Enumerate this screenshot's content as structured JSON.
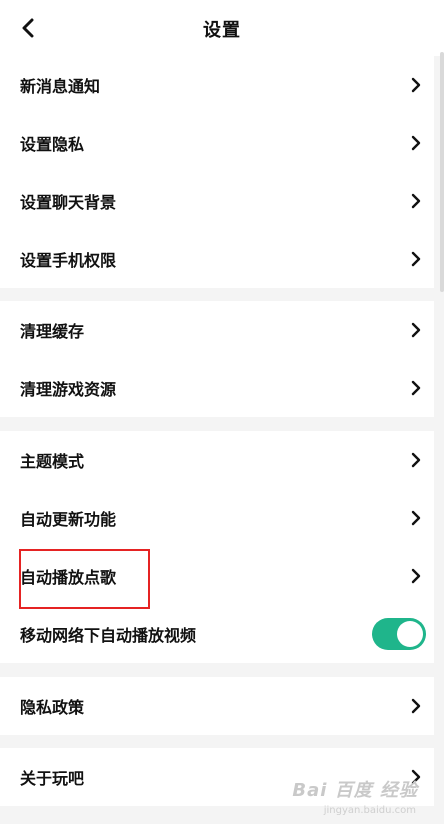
{
  "header": {
    "title": "设置",
    "back_icon": "chevron-left-icon"
  },
  "groups": [
    {
      "items": [
        {
          "label": "新消息通知"
        },
        {
          "label": "设置隐私"
        },
        {
          "label": "设置聊天背景"
        },
        {
          "label": "设置手机权限"
        }
      ]
    },
    {
      "items": [
        {
          "label": "清理缓存"
        },
        {
          "label": "清理游戏资源"
        }
      ]
    },
    {
      "items": [
        {
          "label": "主题模式"
        },
        {
          "label": "自动更新功能"
        },
        {
          "label": "自动播放点歌"
        },
        {
          "label": "移动网络下自动播放视频",
          "toggle": true,
          "toggle_on": true
        }
      ]
    },
    {
      "items": [
        {
          "label": "隐私政策"
        }
      ]
    },
    {
      "items": [
        {
          "label": "关于玩吧"
        }
      ]
    }
  ],
  "colors": {
    "toggle_on": "#1fb58b",
    "highlight_box": "#e52323",
    "page_bg": "#f4f4f4"
  },
  "watermark": {
    "text": "Bai 百度 经验",
    "sub": "jingyan.baidu.com"
  }
}
